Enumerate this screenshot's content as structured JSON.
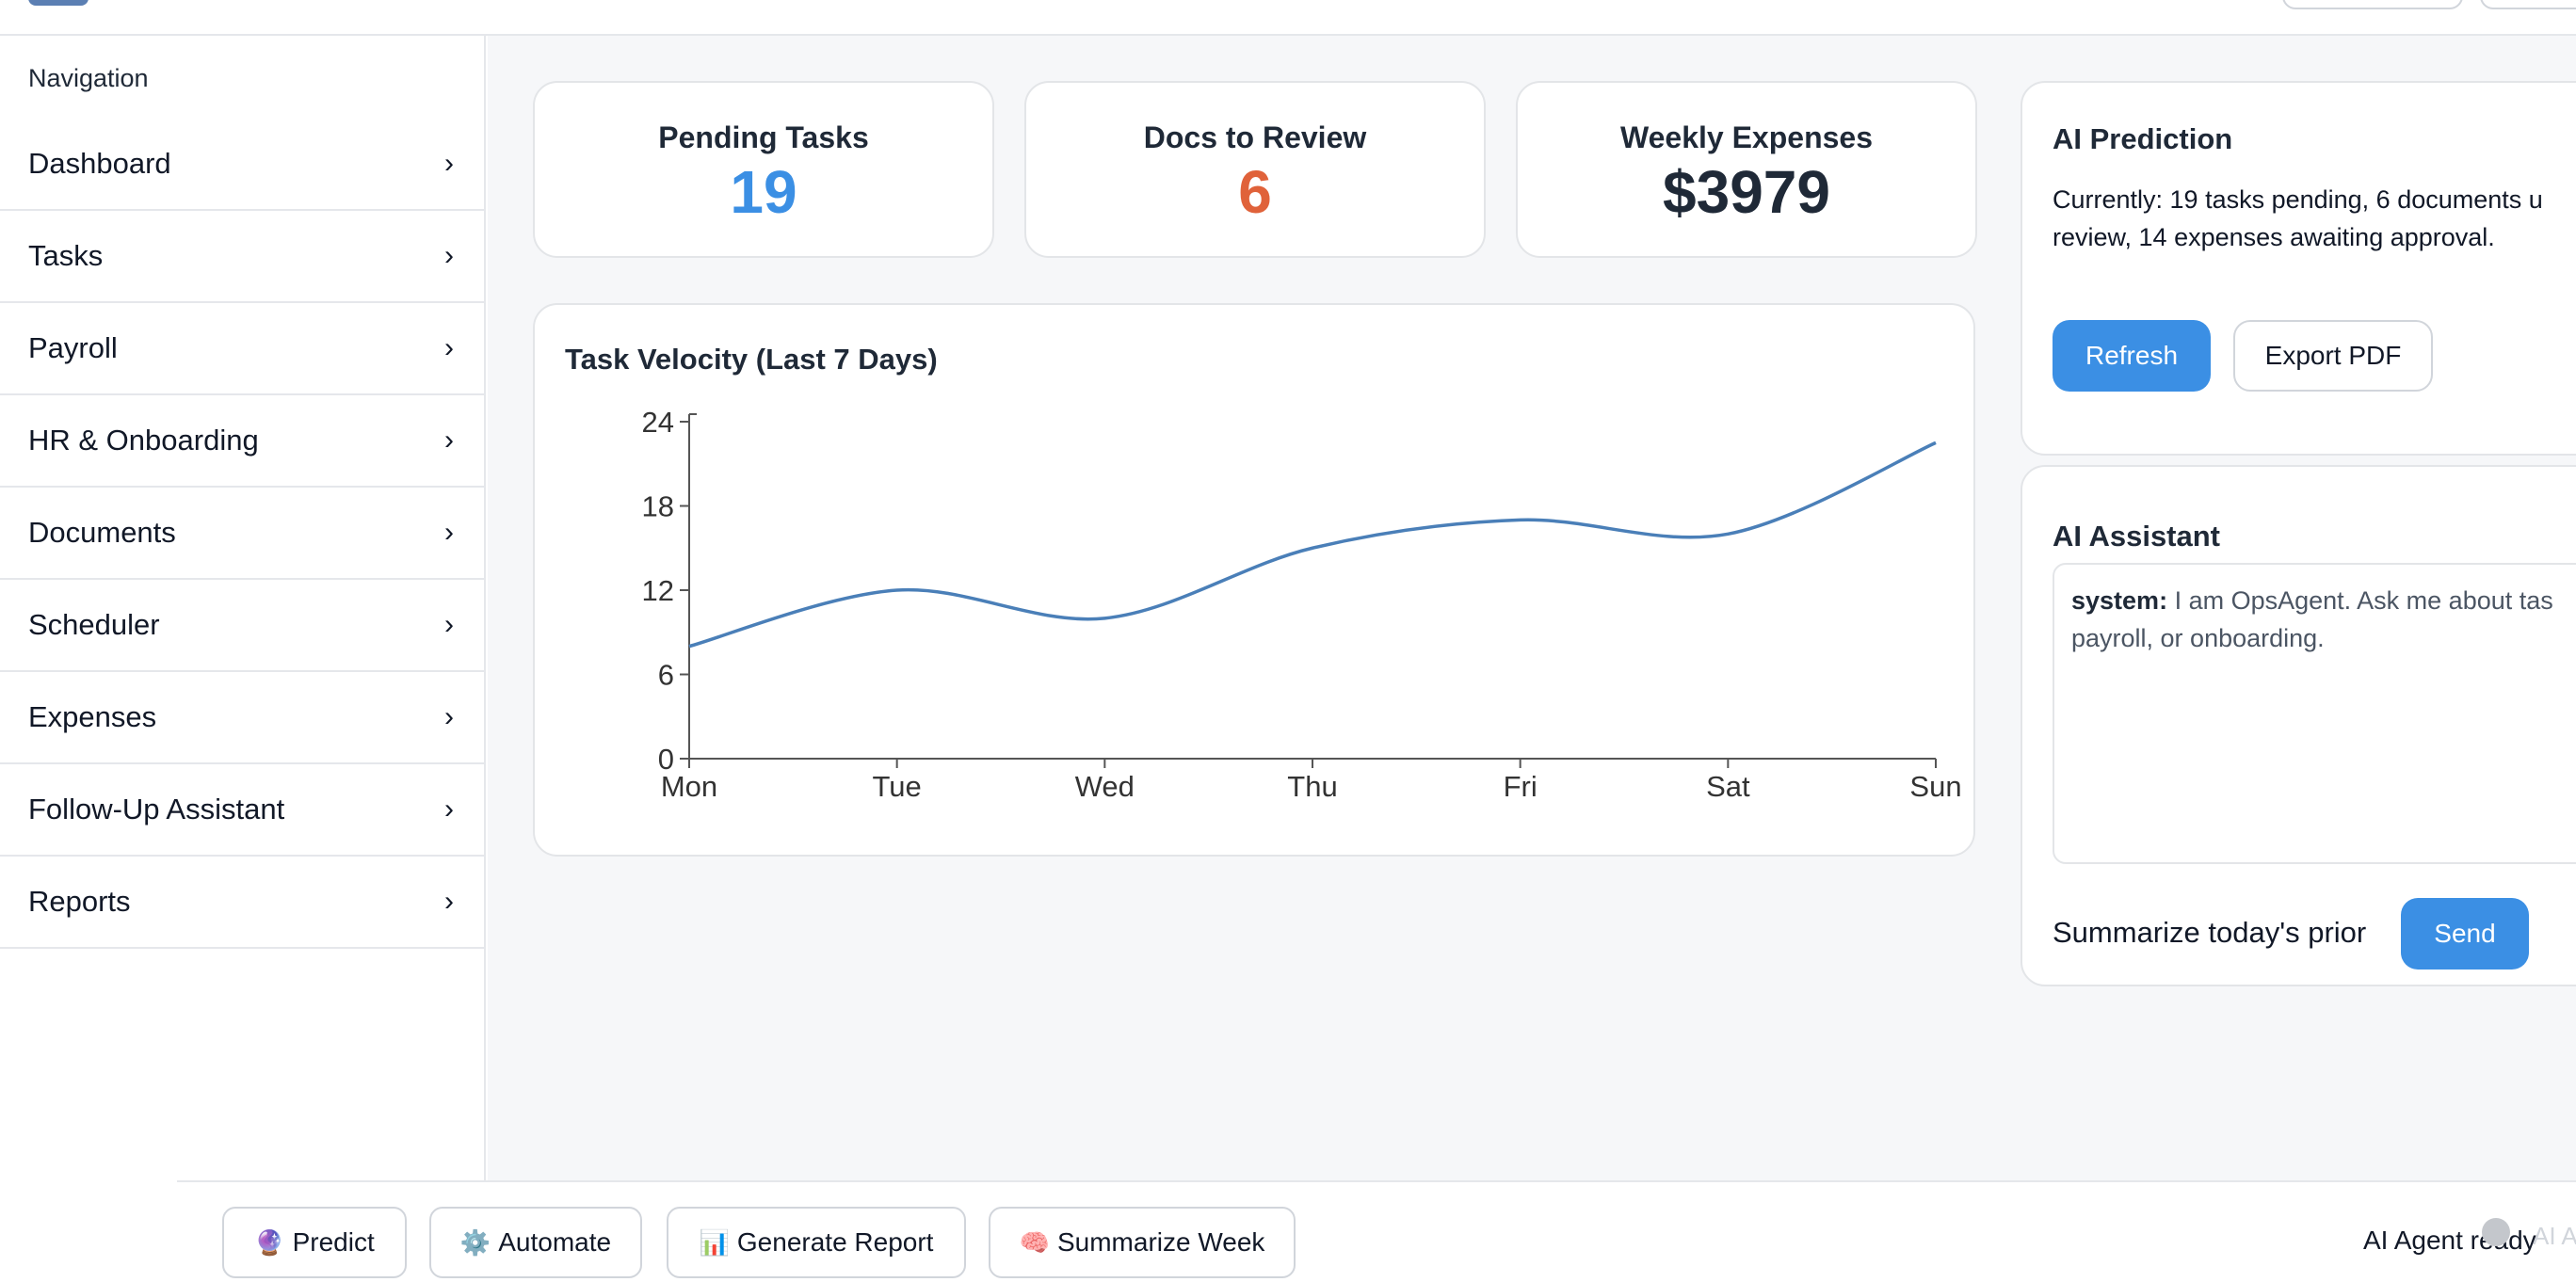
{
  "sidebar": {
    "title": "Navigation",
    "items": [
      {
        "label": "Dashboard",
        "chevron": "›"
      },
      {
        "label": "Tasks",
        "chevron": "›"
      },
      {
        "label": "Payroll",
        "chevron": "›"
      },
      {
        "label": "HR & Onboarding",
        "chevron": "›"
      },
      {
        "label": "Documents",
        "chevron": "›"
      },
      {
        "label": "Scheduler",
        "chevron": "›"
      },
      {
        "label": "Expenses",
        "chevron": "›"
      },
      {
        "label": "Follow-Up Assistant",
        "chevron": "›"
      },
      {
        "label": "Reports",
        "chevron": "›"
      }
    ]
  },
  "stats": [
    {
      "label": "Pending Tasks",
      "value": "19",
      "color": "#3b8fe4"
    },
    {
      "label": "Docs to Review",
      "value": "6",
      "color": "#e0623a"
    },
    {
      "label": "Weekly Expenses",
      "value": "$3979",
      "color": "#1f2937"
    }
  ],
  "chart": {
    "title": "Task Velocity (Last 7 Days)"
  },
  "chart_data": {
    "type": "line",
    "title": "Task Velocity (Last 7 Days)",
    "categories": [
      "Mon",
      "Tue",
      "Wed",
      "Thu",
      "Fri",
      "Sat",
      "Sun"
    ],
    "values": [
      8,
      12,
      10,
      15,
      17,
      16,
      22.5
    ],
    "ylim": [
      0,
      24
    ],
    "yticks": [
      0,
      6,
      12,
      18,
      24
    ],
    "line_color": "#4a7fb8",
    "smooth": true,
    "grid": false
  },
  "ai_prediction": {
    "title": "AI Prediction",
    "line1": "Currently: 19 tasks pending, 6 documents u",
    "line2": "review, 14 expenses awaiting approval.",
    "refresh_label": "Refresh",
    "export_label": "Export PDF"
  },
  "ai_assistant": {
    "title": "AI Assistant",
    "messages": [
      {
        "role": "system:",
        "line1": " I am OpsAgent. Ask me about tas",
        "line2": "payroll, or onboarding."
      }
    ],
    "input_placeholder": "Summarize today's prior",
    "send_label": "Send"
  },
  "bottom_bar": {
    "actions": [
      {
        "icon": "🔮",
        "icon_name": "crystal-ball-icon",
        "label": "Predict"
      },
      {
        "icon": "⚙️",
        "icon_name": "gear-icon",
        "label": "Automate"
      },
      {
        "icon": "📊",
        "icon_name": "bar-chart-icon",
        "label": "Generate Report"
      },
      {
        "icon": "🧠",
        "icon_name": "brain-icon",
        "label": "Summarize Week"
      }
    ],
    "status": "AI Agent ready",
    "status_ghost": "AI A"
  }
}
